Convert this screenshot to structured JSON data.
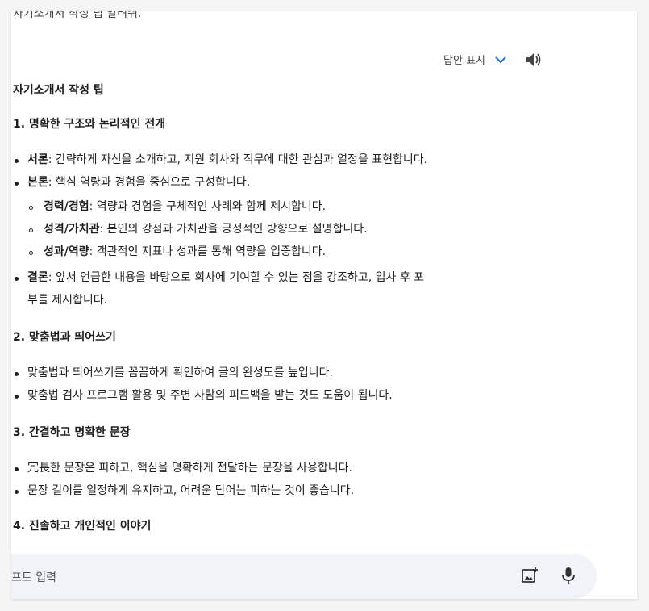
{
  "previous_message": "자기소개서 작성 팁 알려줘.",
  "controls": {
    "drafts_label": "답안 표시"
  },
  "title": "자기소개서 작성 팁",
  "sections": [
    {
      "heading": "1. 명확한 구조와 논리적인 전개",
      "bullets": [
        {
          "bold": "서론",
          "text": ": 간략하게 자신을 소개하고, 지원 회사와 직무에 대한 관심과 열정을 표현합니다."
        },
        {
          "bold": "본론",
          "text": ": 핵심 역량과 경험을 중심으로 구성합니다.",
          "sub": [
            {
              "bold": "경력/경험",
              "text": ": 역량과 경험을 구체적인 사례와 함께 제시합니다."
            },
            {
              "bold": "성격/가치관",
              "text": ": 본인의 강점과 가치관을 긍정적인 방향으로 설명합니다."
            },
            {
              "bold": "성과/역량",
              "text": ": 객관적인 지표나 성과를 통해 역량을 입증합니다."
            }
          ]
        },
        {
          "bold": "결론",
          "text": ": 앞서 언급한 내용을 바탕으로 회사에 기여할 수 있는 점을 강조하고, 입사 후 포",
          "text2": "부를 제시합니다."
        }
      ]
    },
    {
      "heading": "2. 맞춤법과 띄어쓰기",
      "bullets": [
        {
          "text": "맞춤법과 띄어쓰기를 꼼꼼하게 확인하여 글의 완성도를 높입니다."
        },
        {
          "text": "맞춤법 검사 프로그램 활용 및 주변 사람의 피드백을 받는 것도 도움이 됩니다."
        }
      ]
    },
    {
      "heading": "3. 간결하고 명확한 문장",
      "bullets": [
        {
          "text": "冗長한 문장은 피하고, 핵심을 명확하게 전달하는 문장을 사용합니다."
        },
        {
          "text": "문장 길이를 일정하게 유지하고, 어려운 단어는 피하는 것이 좋습니다."
        }
      ]
    },
    {
      "heading": "4. 진솔하고 개인적인 이야기"
    }
  ],
  "input": {
    "placeholder": "프트 입력"
  }
}
